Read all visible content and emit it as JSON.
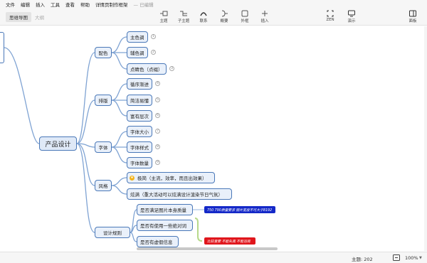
{
  "menu": {
    "items": [
      "文件",
      "编辑",
      "插入",
      "工具",
      "查看",
      "帮助",
      "详情页制作框架"
    ],
    "saved": "— 已编辑"
  },
  "view_tabs": {
    "mindmap": "思维导图",
    "outline": "大纲"
  },
  "toolbar": {
    "topic": "主题",
    "subtopic": "子主题",
    "relation": "联系",
    "summary": "概要",
    "boundary": "外框",
    "insert": "插入",
    "zen": "ZEN",
    "present": "演示",
    "panel": "面板"
  },
  "mindmap": {
    "root": "产品设计",
    "branches": {
      "color": {
        "label": "配色",
        "leaves": [
          {
            "label": "主色调",
            "badge": "1"
          },
          {
            "label": "辅色调",
            "badge": "2"
          },
          {
            "label": "点睛色（点缀）",
            "badge": "3"
          }
        ]
      },
      "layout": {
        "label": "排版",
        "leaves": [
          {
            "label": "循序渐进",
            "badge": "4"
          },
          {
            "label": "简洁易懂",
            "badge": "5"
          },
          {
            "label": "富有层次",
            "badge": "6"
          }
        ]
      },
      "font": {
        "label": "字体",
        "leaves": [
          {
            "label": "字体大小",
            "badge": "7"
          },
          {
            "label": "字体样式",
            "badge": "8"
          },
          {
            "label": "字体数量",
            "badge": "9"
          }
        ]
      },
      "style": {
        "label": "风格",
        "leaves": [
          {
            "label": "极简（主流，效率，而且出效果）"
          },
          {
            "label": "炫满（重大活动可以炫满设计渲染节日气氛）"
          }
        ]
      },
      "rules": {
        "label": "设计规则",
        "leaves": [
          {
            "label": "是否满足图片本身质量"
          },
          {
            "label": "是否有使用一些绝对词"
          },
          {
            "label": "是否有虚假信息"
          }
        ],
        "notes": {
          "blue": "750 790质量要求 图片宽度不可大于8192",
          "red": "比较重要 不能失真 不能违规"
        }
      }
    }
  },
  "status": {
    "topics": "主题: 202",
    "zoom": "100%"
  },
  "colors": {
    "node_border": "#4a78b8",
    "node_fill": "#e9f0fa",
    "note_blue": "#1428c8",
    "note_red": "#e0161c",
    "summary_bracket": "#b7d98a"
  }
}
